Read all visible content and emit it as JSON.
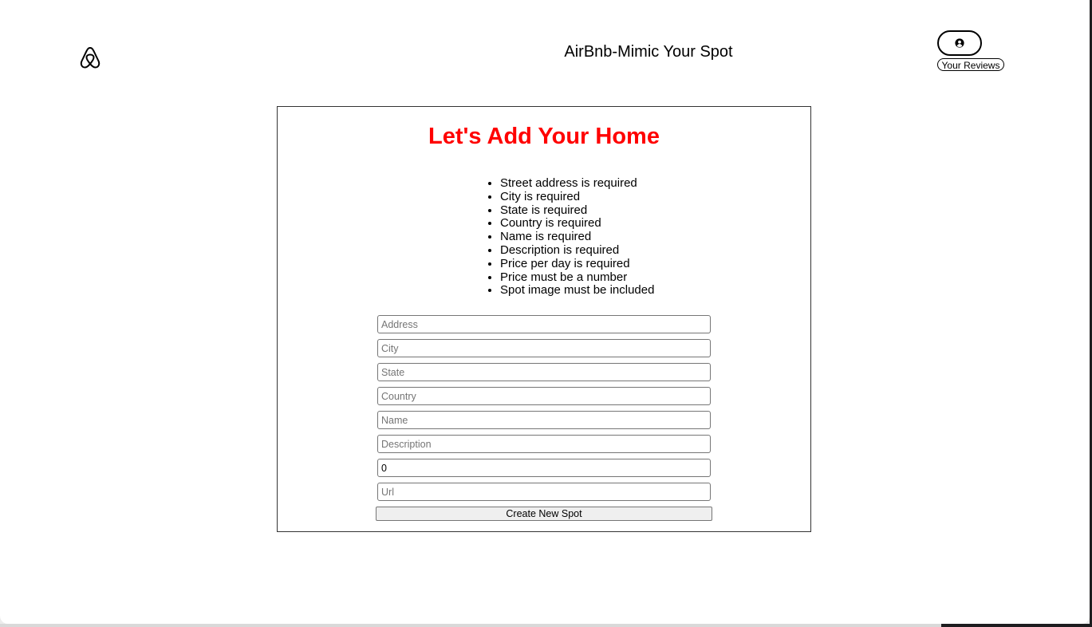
{
  "header": {
    "logo_icon": "airbnb-logo-icon",
    "title": "AirBnb-Mimic Your Spot",
    "profile_icon": "user-circle-icon",
    "reviews_button": "Your Reviews"
  },
  "form": {
    "heading": "Let's Add Your Home",
    "heading_color": "#ff0000",
    "errors": [
      "Street address is required",
      "City is required",
      "State is required",
      "Country is required",
      "Name is required",
      "Description is required",
      "Price per day is required",
      "Price must be a number",
      "Spot image must be included"
    ],
    "fields": {
      "address": {
        "placeholder": "Address",
        "value": ""
      },
      "city": {
        "placeholder": "City",
        "value": ""
      },
      "state": {
        "placeholder": "State",
        "value": ""
      },
      "country": {
        "placeholder": "Country",
        "value": ""
      },
      "name": {
        "placeholder": "Name",
        "value": ""
      },
      "description": {
        "placeholder": "Description",
        "value": ""
      },
      "price": {
        "placeholder": "",
        "value": "0"
      },
      "url": {
        "placeholder": "Url",
        "value": ""
      }
    },
    "submit_label": "Create New Spot"
  }
}
